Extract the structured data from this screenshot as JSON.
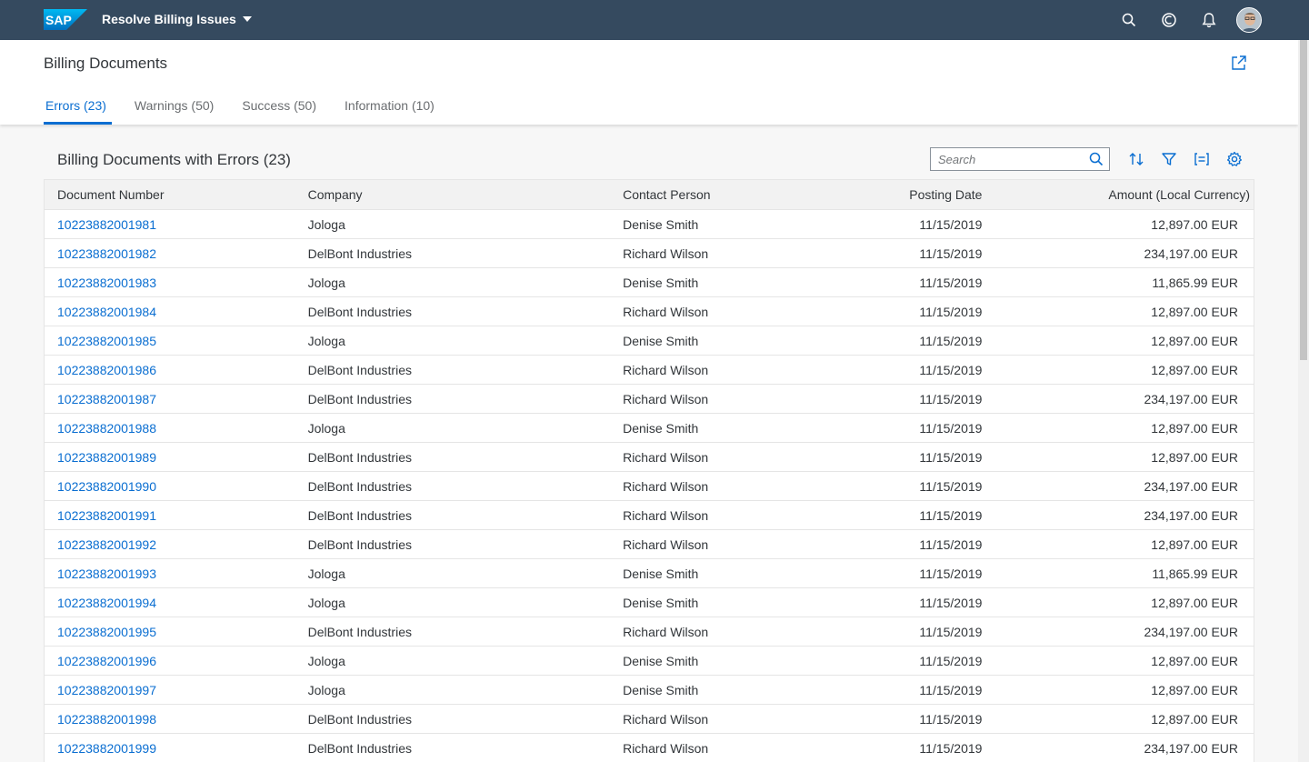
{
  "shell": {
    "logo_text": "SAP",
    "app_title": "Resolve Billing Issues",
    "icons": [
      "search-icon",
      "copilot-icon",
      "bell-icon",
      "avatar"
    ],
    "color": "#354a5f"
  },
  "page": {
    "title": "Billing Documents",
    "tabs": [
      {
        "label": "Errors (23)",
        "active": true
      },
      {
        "label": "Warnings (50)",
        "active": false
      },
      {
        "label": "Success (50)",
        "active": false
      },
      {
        "label": "Information (10)",
        "active": false
      }
    ]
  },
  "table": {
    "title": "Billing Documents with Errors (23)",
    "search_placeholder": "Search",
    "toolbar_icons": [
      "sort-icon",
      "filter-icon",
      "group-icon",
      "settings-icon"
    ],
    "columns": [
      "Document Number",
      "Company",
      "Contact Person",
      "Posting Date",
      "Amount (Local Currency)"
    ],
    "rows": [
      [
        "10223882001981",
        "Jologa",
        "Denise Smith",
        "11/15/2019",
        "12,897.00 EUR"
      ],
      [
        "10223882001982",
        "DelBont Industries",
        "Richard Wilson",
        "11/15/2019",
        "234,197.00 EUR"
      ],
      [
        "10223882001983",
        "Jologa",
        "Denise Smith",
        "11/15/2019",
        "11,865.99 EUR"
      ],
      [
        "10223882001984",
        "DelBont Industries",
        "Richard Wilson",
        "11/15/2019",
        "12,897.00 EUR"
      ],
      [
        "10223882001985",
        "Jologa",
        "Denise Smith",
        "11/15/2019",
        "12,897.00 EUR"
      ],
      [
        "10223882001986",
        "DelBont Industries",
        "Richard Wilson",
        "11/15/2019",
        "12,897.00 EUR"
      ],
      [
        "10223882001987",
        "DelBont Industries",
        "Richard Wilson",
        "11/15/2019",
        "234,197.00 EUR"
      ],
      [
        "10223882001988",
        "Jologa",
        "Denise Smith",
        "11/15/2019",
        "12,897.00 EUR"
      ],
      [
        "10223882001989",
        "DelBont Industries",
        "Richard Wilson",
        "11/15/2019",
        "12,897.00 EUR"
      ],
      [
        "10223882001990",
        "DelBont Industries",
        "Richard Wilson",
        "11/15/2019",
        "234,197.00 EUR"
      ],
      [
        "10223882001991",
        "DelBont Industries",
        "Richard Wilson",
        "11/15/2019",
        "234,197.00 EUR"
      ],
      [
        "10223882001992",
        "DelBont Industries",
        "Richard Wilson",
        "11/15/2019",
        "12,897.00 EUR"
      ],
      [
        "10223882001993",
        "Jologa",
        "Denise Smith",
        "11/15/2019",
        "11,865.99 EUR"
      ],
      [
        "10223882001994",
        "Jologa",
        "Denise Smith",
        "11/15/2019",
        "12,897.00 EUR"
      ],
      [
        "10223882001995",
        "DelBont Industries",
        "Richard Wilson",
        "11/15/2019",
        "234,197.00 EUR"
      ],
      [
        "10223882001996",
        "Jologa",
        "Denise Smith",
        "11/15/2019",
        "12,897.00 EUR"
      ],
      [
        "10223882001997",
        "Jologa",
        "Denise Smith",
        "11/15/2019",
        "12,897.00 EUR"
      ],
      [
        "10223882001998",
        "DelBont Industries",
        "Richard Wilson",
        "11/15/2019",
        "12,897.00 EUR"
      ],
      [
        "10223882001999",
        "DelBont Industries",
        "Richard Wilson",
        "11/15/2019",
        "234,197.00 EUR"
      ]
    ]
  },
  "colors": {
    "accent": "#0a6ed1",
    "text": "#32363a",
    "background": "#f7f7f7"
  }
}
